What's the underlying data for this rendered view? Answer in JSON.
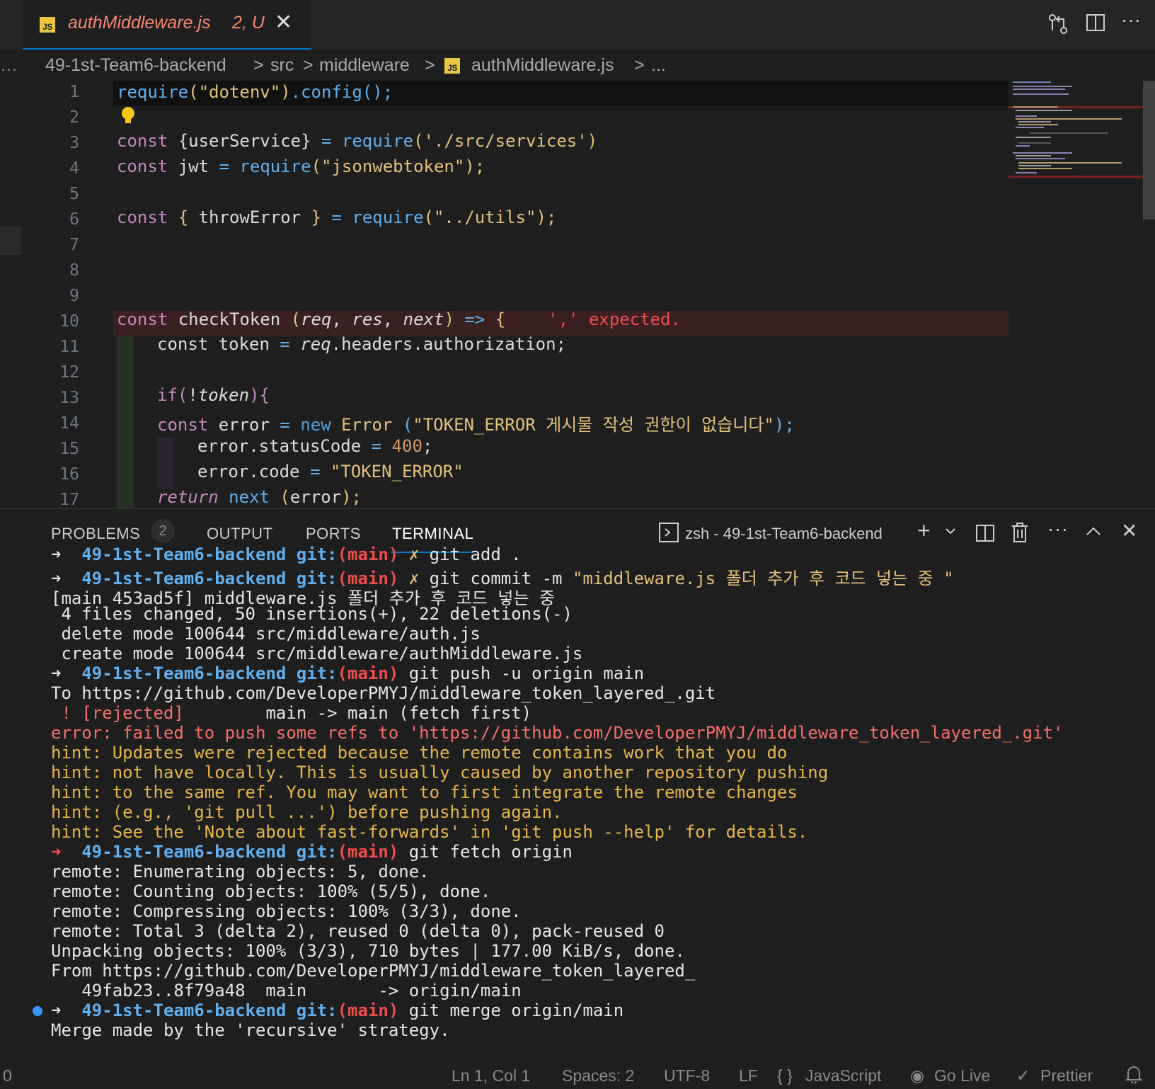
{
  "tab": {
    "filename": "authMiddleware.js",
    "badge": "2, U",
    "js_label": "JS"
  },
  "breadcrumb": {
    "root": "49-1st-Team6-backend",
    "seg1": "src",
    "seg2": "middleware",
    "file": "authMiddleware.js",
    "more": "...",
    "sep": ">"
  },
  "editor": {
    "line_numbers": [
      "1",
      "2",
      "3",
      "4",
      "5",
      "6",
      "7",
      "8",
      "9",
      "10",
      "11",
      "12",
      "13",
      "14",
      "15",
      "16",
      "17"
    ],
    "lines": {
      "l1": {
        "a": "require",
        "b": "(\"dotenv\")",
        "c": ".config();"
      },
      "l3": {
        "a": "const ",
        "b": "{userService}",
        "c": " = ",
        "d": "require",
        "e": "('./src/services')"
      },
      "l4": {
        "a": "const ",
        "b": "jwt",
        "c": " = ",
        "d": "require",
        "e": "(\"jsonwebtoken\");"
      },
      "l6": {
        "a": "const ",
        "b": "{ ",
        "c": "throwError",
        "d": " }",
        "e": " = ",
        "f": "require",
        "g": "(\"../utils\");"
      },
      "l10": {
        "a": "const ",
        "b": "checkToken ",
        "c": "(",
        "d": "req",
        "e": ", ",
        "f": "res",
        "g": ", ",
        "h": "next",
        "i": ") ",
        "j": "=> ",
        "k": "{",
        "err": "',' expected."
      },
      "l11": {
        "a": "const ",
        "b": "token",
        "c": " = ",
        "d": "req",
        "e": ".headers.authorization;"
      },
      "l13": {
        "a": "if",
        "b": "(",
        "c": "!",
        "d": "token",
        "e": "){"
      },
      "l14": {
        "a": "const ",
        "b": "error",
        "c": " = ",
        "d": "new ",
        "e": "Error ",
        "f": "(",
        "g": "\"TOKEN_ERROR 게시물 작성 권한이 없습니다\"",
        "h": ");"
      },
      "l15": {
        "a": "error.statusCode",
        "b": " = ",
        "c": "400",
        "d": ";"
      },
      "l16": {
        "a": "error.code",
        "b": " = ",
        "c": "\"TOKEN_ERROR\""
      },
      "l17": {
        "a": "return ",
        "b": "next ",
        "c": "(",
        "d": "error",
        "e": ");"
      }
    }
  },
  "panel": {
    "tabs": {
      "problems": "PROBLEMS",
      "output": "OUTPUT",
      "ports": "PORTS",
      "terminal": "TERMINAL"
    },
    "problems_count": "2",
    "shell_label": "zsh - 49-1st-Team6-backend"
  },
  "terminal": {
    "prompt_dir": "49-1st-Team6-backend",
    "git": "git:",
    "branch": "(main)",
    "x": "✗",
    "arrow": "➜",
    "cmd1": "git add .",
    "cmd2a": "git commit -m ",
    "cmd2b": "\"middleware.js 폴더 추가 후 코드 넣는 중 \"",
    "out1": "[main 453ad5f] middleware.js 폴더 추가 후 코드 넣는 중",
    "out2": " 4 files changed, 50 insertions(+), 22 deletions(-)",
    "out3": " delete mode 100644 src/middleware/auth.js",
    "out4": " create mode 100644 src/middleware/authMiddleware.js",
    "cmd3": "git push -u origin main",
    "out5": "To https://github.com/DeveloperPMYJ/middleware_token_layered_.git",
    "out6a": " ! [rejected]",
    "out6b": "        main -> main (fetch first)",
    "err1": "error: failed to push some refs to 'https://github.com/DeveloperPMYJ/middleware_token_layered_.git'",
    "hint1": "hint: Updates were rejected because the remote contains work that you do",
    "hint2": "hint: not have locally. This is usually caused by another repository pushing",
    "hint3": "hint: to the same ref. You may want to first integrate the remote changes",
    "hint4": "hint: (e.g., 'git pull ...') before pushing again.",
    "hint5": "hint: See the 'Note about fast-forwards' in 'git push --help' for details.",
    "cmd4": "git fetch origin",
    "out7": "remote: Enumerating objects: 5, done.",
    "out8": "remote: Counting objects: 100% (5/5), done.",
    "out9": "remote: Compressing objects: 100% (3/3), done.",
    "out10": "remote: Total 3 (delta 2), reused 0 (delta 0), pack-reused 0",
    "out11": "Unpacking objects: 100% (3/3), 710 bytes | 177.00 KiB/s, done.",
    "out12": "From https://github.com/DeveloperPMYJ/middleware_token_layered_",
    "out13": "   49fab23..8f79a48  main       -> origin/main",
    "cmd5": "git merge origin/main",
    "out14": "Merge made by the 'recursive' strategy."
  },
  "statusbar": {
    "left": "0",
    "position": "Ln 1, Col 1",
    "spaces": "Spaces: 2",
    "encoding": "UTF-8",
    "eol": "LF",
    "lang_icon": "{ }",
    "language": "JavaScript",
    "golive": "Go Live",
    "prettier": "Prettier"
  },
  "colors": {
    "accent": "#007acc",
    "error": "#f14c4c",
    "hint": "#e8b54a"
  }
}
